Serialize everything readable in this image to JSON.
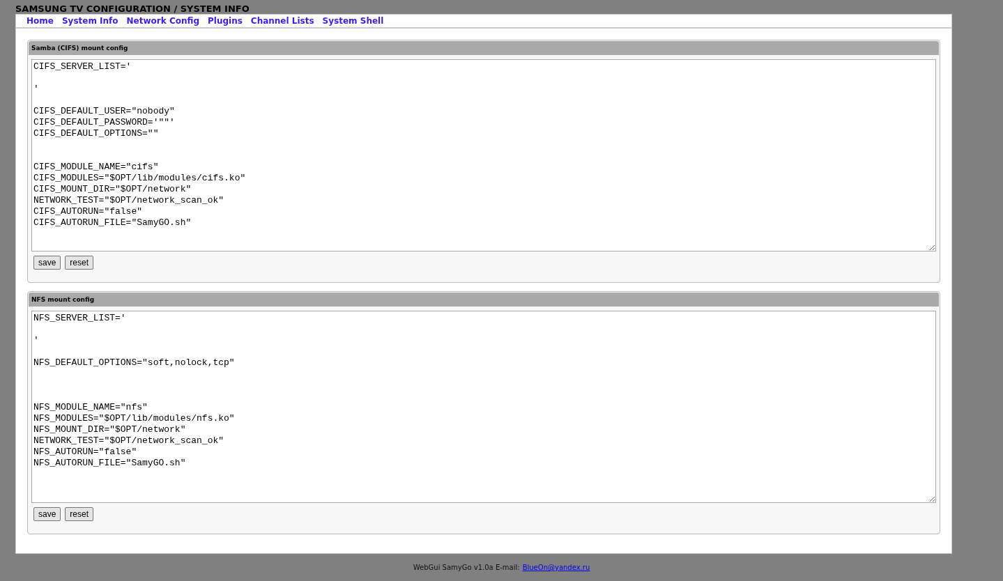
{
  "page_title": "SAMSUNG TV CONFIGURATION / SYSTEM INFO",
  "nav": [
    {
      "label": "Home"
    },
    {
      "label": "System Info"
    },
    {
      "label": "Network Config"
    },
    {
      "label": "Plugins"
    },
    {
      "label": "Channel Lists"
    },
    {
      "label": "System Shell"
    }
  ],
  "sections": [
    {
      "title": "Samba (CIFS) mount config",
      "config_text": "CIFS_SERVER_LIST='\n\n'\n\nCIFS_DEFAULT_USER=\"nobody\"\nCIFS_DEFAULT_PASSWORD='\"\"'\nCIFS_DEFAULT_OPTIONS=\"\"\n\n\nCIFS_MODULE_NAME=\"cifs\"\nCIFS_MODULES=\"$OPT/lib/modules/cifs.ko\"\nCIFS_MOUNT_DIR=\"$OPT/network\"\nNETWORK_TEST=\"$OPT/network_scan_ok\"\nCIFS_AUTORUN=\"false\"\nCIFS_AUTORUN_FILE=\"SamyGO.sh\"",
      "buttons": [
        "save",
        "reset"
      ]
    },
    {
      "title": "NFS mount config",
      "config_text": "NFS_SERVER_LIST='\n\n'\n\nNFS_DEFAULT_OPTIONS=\"soft,nolock,tcp\"\n\n\n\nNFS_MODULE_NAME=\"nfs\"\nNFS_MODULES=\"$OPT/lib/modules/nfs.ko\"\nNFS_MOUNT_DIR=\"$OPT/network\"\nNETWORK_TEST=\"$OPT/network_scan_ok\"\nNFS_AUTORUN=\"false\"\nNFS_AUTORUN_FILE=\"SamyGO.sh\"",
      "buttons": [
        "save",
        "reset"
      ]
    }
  ],
  "footer": {
    "text": "WebGui SamyGo v1.0a E-mail:",
    "email": "BlueOn@yandex.ru"
  }
}
